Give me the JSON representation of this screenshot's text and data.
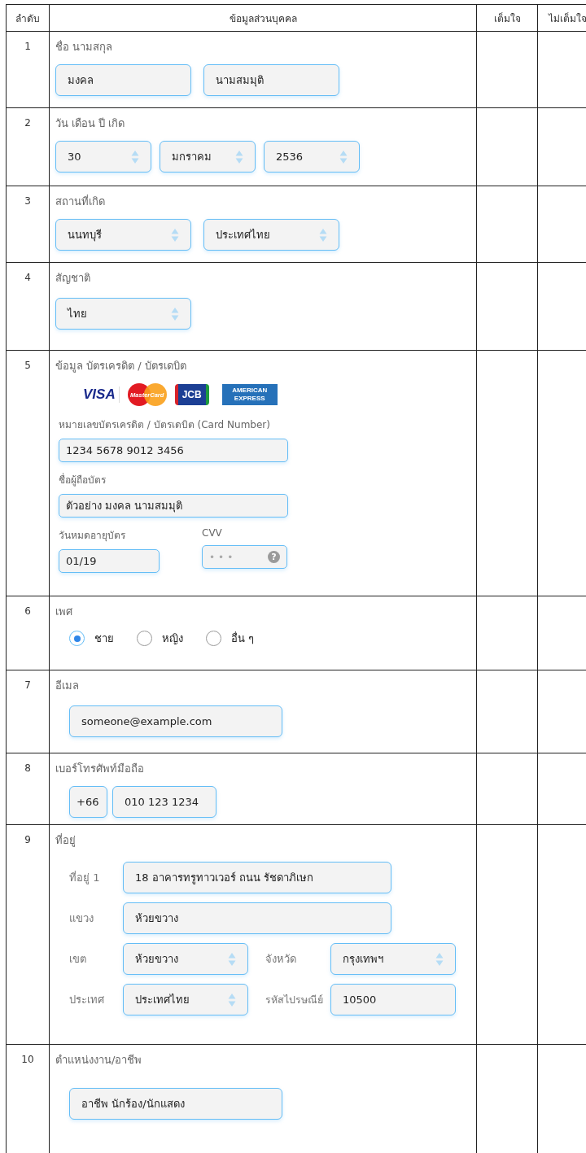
{
  "table": {
    "columns": [
      "ลำดับ",
      "ข้อมูลส่วนบุคคล",
      "เต็มใจ",
      "ไม่เต็มใจ"
    ],
    "rows": [
      {
        "number": "1",
        "label": "ชื่อ นามสกุล",
        "kind": "name",
        "fields": [
          {
            "kind": "text",
            "value": "มงคล"
          },
          {
            "kind": "text",
            "value": "นามสมมุติ"
          }
        ]
      },
      {
        "number": "2",
        "label": "วัน เดือน ปี เกิด",
        "kind": "date",
        "fields": [
          {
            "kind": "select",
            "value": "30"
          },
          {
            "kind": "select",
            "value": "มกราคม"
          },
          {
            "kind": "select",
            "value": "2536"
          }
        ]
      },
      {
        "number": "3",
        "label": "สถานที่เกิด",
        "kind": "place",
        "fields": [
          {
            "kind": "select",
            "value": "นนทบุรี"
          },
          {
            "kind": "select",
            "value": "ประเทศไทย"
          }
        ]
      },
      {
        "number": "4",
        "label": "สัญชาติ",
        "kind": "nationality",
        "fields": [
          {
            "kind": "select",
            "value": "ไทย"
          }
        ]
      },
      {
        "number": "5",
        "label": "ข้อมูล บัตรเครดิต / บัตรเดบิต",
        "kind": "card",
        "logos": [
          {
            "kind": "visa",
            "text": "VISA"
          },
          {
            "kind": "mastercard",
            "text": "MasterCard"
          },
          {
            "kind": "jcb",
            "text": "JCB"
          },
          {
            "kind": "amex",
            "text": "AMERICAN EXPRESS"
          }
        ],
        "card_number": {
          "label": "หมายเลขบัตรเครดิต / บัตรเดบิต (Card Number)",
          "value": "1234 5678 9012 3456"
        },
        "holder": {
          "label": "ชื่อผู้ถือบัตร",
          "value": "ตัวอย่าง มงคล นามสมมุติ"
        },
        "expiry": {
          "label": "วันหมดอายุบัตร",
          "value": "01/19"
        },
        "cvv": {
          "label": "CVV",
          "placeholder": "•••",
          "help": "?"
        }
      },
      {
        "number": "6",
        "label": "เพศ",
        "kind": "gender",
        "options": [
          {
            "label": "ชาย",
            "selected": true
          },
          {
            "label": "หญิง",
            "selected": false
          },
          {
            "label": "อื่น ๆ",
            "selected": false
          }
        ]
      },
      {
        "number": "7",
        "label": "อีเมล",
        "kind": "email",
        "fields": [
          {
            "kind": "text",
            "value": "someone@example.com"
          }
        ]
      },
      {
        "number": "8",
        "label": "เบอร์โทรศัพท์มือถือ",
        "kind": "phone",
        "fields": [
          {
            "kind": "text",
            "value": "+66"
          },
          {
            "kind": "text",
            "value": "010 123 1234"
          }
        ]
      },
      {
        "number": "9",
        "label": "ที่อยู่",
        "kind": "address",
        "lines": [
          {
            "label": "ที่อยู่ 1",
            "kind": "text",
            "value": "18 อาคารทรูทาวเวอร์ ถนน รัชดาภิเษก"
          },
          {
            "label": "แขวง",
            "kind": "text",
            "value": "ห้วยขวาง"
          },
          {
            "label": "เขต",
            "kind": "select",
            "value": "ห้วยขวาง"
          },
          {
            "label": "จังหวัด",
            "kind": "select",
            "value": "กรุงเทพฯ"
          },
          {
            "label": "ประเทศ",
            "kind": "select",
            "value": "ประเทศไทย"
          },
          {
            "label": "รหัสไปรษณีย์",
            "kind": "text",
            "value": "10500"
          }
        ]
      },
      {
        "number": "10",
        "label": "ตำแหน่งงาน/อาชีพ",
        "kind": "occupation",
        "fields": [
          {
            "kind": "text",
            "value": "อาชีพ นักร้อง/นักแสดง"
          }
        ]
      }
    ]
  }
}
